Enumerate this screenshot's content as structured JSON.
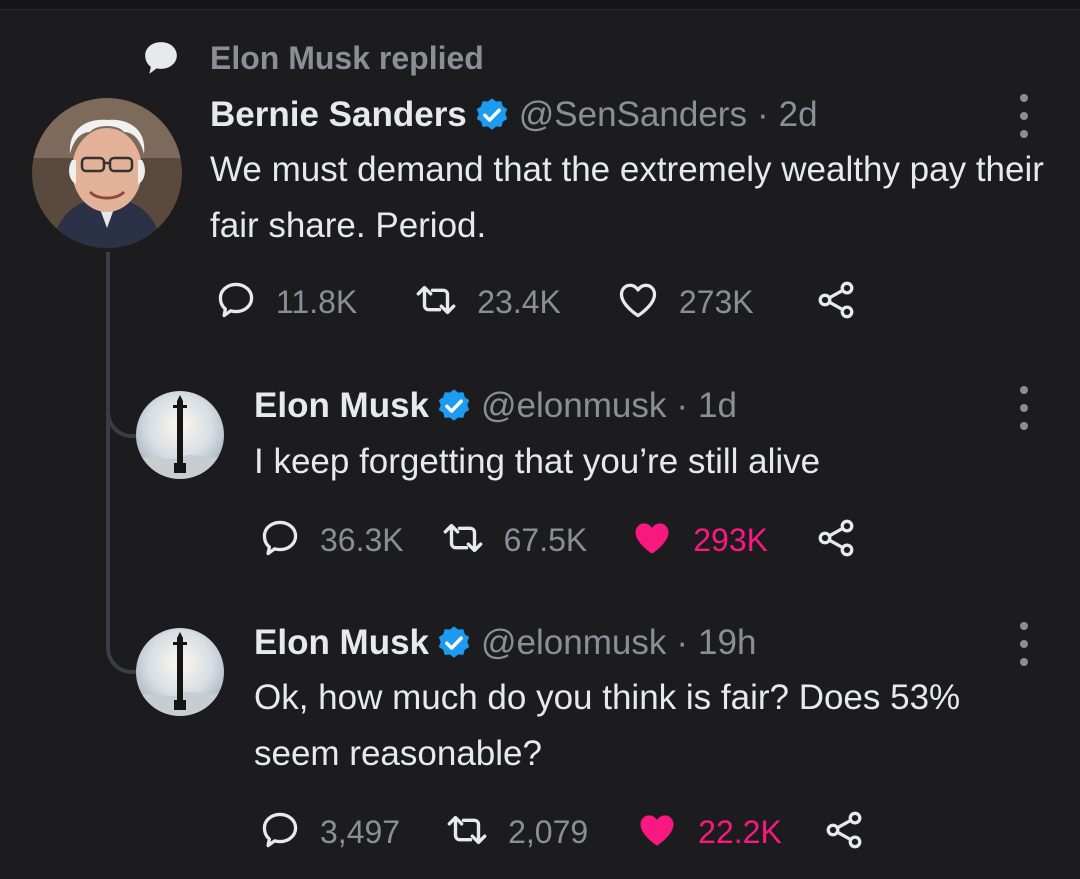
{
  "context": {
    "label": "Elon Musk replied",
    "icon": "speech-bubble-icon"
  },
  "tweets": [
    {
      "name": "Bernie Sanders",
      "handle": "@SenSanders",
      "separator": "·",
      "time": "2d",
      "text": "We must demand that the extremely wealthy pay their fair share. Period.",
      "replies": "11.8K",
      "retweets": "23.4K",
      "likes": "273K",
      "liked": false
    },
    {
      "name": "Elon Musk",
      "handle": "@elonmusk",
      "separator": "·",
      "time": "1d",
      "text": "I keep forgetting that you’re still alive",
      "replies": "36.3K",
      "retweets": "67.5K",
      "likes": "293K",
      "liked": true
    },
    {
      "name": "Elon Musk",
      "handle": "@elonmusk",
      "separator": "·",
      "time": "19h",
      "text": "Ok, how much do you think is fair? Does 53% seem reasonable?",
      "replies": "3,497",
      "retweets": "2,079",
      "likes": "22.2K",
      "liked": true
    }
  ],
  "colors": {
    "background": "#1c1c1e",
    "text": "#e7e9ea",
    "muted": "#8b8f94",
    "verified": "#1d9bf0",
    "like": "#f91880",
    "thread_line": "#3a3d41"
  }
}
